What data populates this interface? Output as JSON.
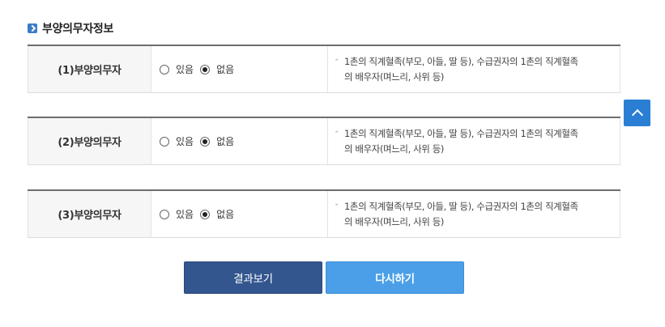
{
  "section": {
    "title": "부양의무자정보"
  },
  "rows": [
    {
      "label": "(1)부양의무자",
      "option_yes": "있음",
      "option_no": "없음",
      "selected": "없음",
      "desc_line1": "1촌의 직계혈족(부모, 아들, 딸 등), 수급권자의 1촌의 직계혈족",
      "desc_line2": "의 배우자(며느리, 사위 등)"
    },
    {
      "label": "(2)부양의무자",
      "option_yes": "있음",
      "option_no": "없음",
      "selected": "없음",
      "desc_line1": "1촌의 직계혈족(부모, 아들, 딸 등), 수급권자의 1촌의 직계혈족",
      "desc_line2": "의 배우자(며느리, 사위 등)"
    },
    {
      "label": "(3)부양의무자",
      "option_yes": "있음",
      "option_no": "없음",
      "selected": "없음",
      "desc_line1": "1촌의 직계혈족(부모, 아들, 딸 등), 수급권자의 1촌의 직계혈족",
      "desc_line2": "의 배우자(며느리, 사위 등)"
    }
  ],
  "buttons": {
    "result": "결과보기",
    "reset": "다시하기"
  },
  "icons": {
    "section_bullet": "arrow-bullet-icon",
    "scroll_top": "chevron-up-icon"
  },
  "colors": {
    "accent": "#2a7fd4",
    "result_button": "#33568f",
    "reset_button": "#4a9fe8"
  }
}
